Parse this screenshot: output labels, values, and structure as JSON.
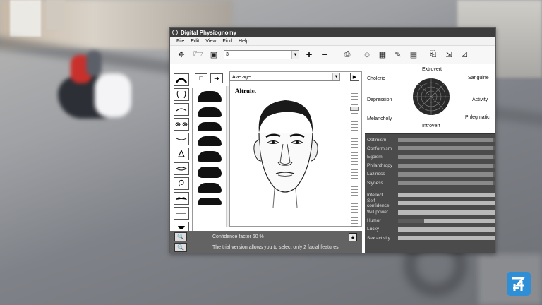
{
  "window": {
    "title": "Digital Physiognomy"
  },
  "menu": [
    "File",
    "Edit",
    "View",
    "Find",
    "Help"
  ],
  "toolbar": {
    "profile_value": "3",
    "plus_label": "+",
    "minus_label": "−",
    "icons": [
      "move-icon",
      "open-folder-icon",
      "save-icon",
      "stamp-icon",
      "portrait-icon",
      "photo-icon",
      "edit-icon",
      "ppt-icon",
      "print-icon",
      "export-icon",
      "check-icon"
    ]
  },
  "features": {
    "buttons": [
      "hair-icon",
      "square-icon",
      "arrow-icon",
      "face-outline-icon",
      "eyebrow-icon",
      "eyes-icon",
      "nose-icon",
      "mouth-icon",
      "ear-icon",
      "mustache-icon",
      "lips-icon",
      "chin-icon"
    ],
    "hair_count": 8
  },
  "middle": {
    "average_label": "Average",
    "face_title": "Altruist",
    "scale_level": 0.1
  },
  "bottom": {
    "confidence_text": "Confidence factor    60    %",
    "trial_text": "The trial version allows you to select only 2 facial features"
  },
  "temperament": {
    "extrovert": "Extrovert",
    "introvert": "Introvert",
    "choleric": "Choleric",
    "sanguine": "Sanguine",
    "depression": "Depression",
    "activity": "Activity",
    "melancholy": "Melancholy",
    "phlegmatic": "Phlegmatic"
  },
  "traits_group1": [
    {
      "name": "Optimism",
      "value": 0.98
    },
    {
      "name": "Conformism",
      "value": 0.98
    },
    {
      "name": "Egoism",
      "value": 0.98
    },
    {
      "name": "Philanthropy",
      "value": 0.98
    },
    {
      "name": "Laziness",
      "value": 0.98
    },
    {
      "name": "Slyness",
      "value": 0.98
    }
  ],
  "traits_group2": [
    {
      "name": "Intellect",
      "value": 1.0
    },
    {
      "name": "Self-confidence",
      "value": 1.0
    },
    {
      "name": "Will power",
      "value": 1.0
    },
    {
      "name": "Humor",
      "value": 0.27
    },
    {
      "name": "Lucky",
      "value": 1.0
    },
    {
      "name": "Sex activity",
      "value": 1.0
    }
  ],
  "colors": {
    "titlebar": "#3d3d3d",
    "panel_dark": "#4b4b4b",
    "bar_fill": "#b9b9b9",
    "logo": "#2e8fd6"
  }
}
